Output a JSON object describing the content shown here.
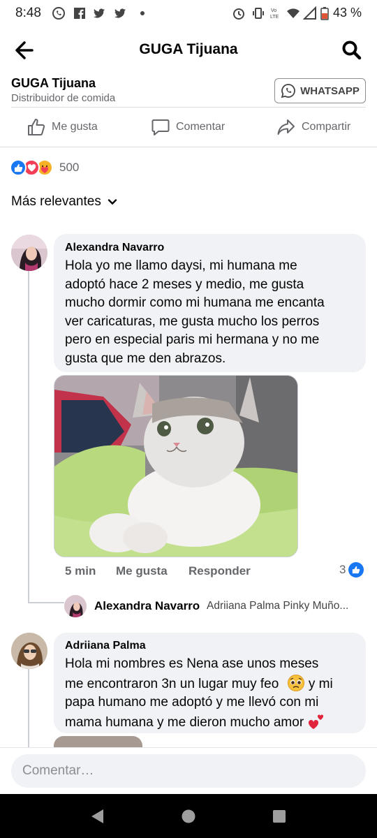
{
  "status_bar": {
    "time": "8:48",
    "battery": "43 %"
  },
  "top_bar": {
    "title": "GUGA Tijuana"
  },
  "page_header": {
    "name": "GUGA Tijuana",
    "category": "Distribuidor de comida",
    "whatsapp_label": "WHATSAPP"
  },
  "actions": {
    "like": "Me gusta",
    "comment": "Comentar",
    "share": "Compartir"
  },
  "reactions": {
    "count": "500",
    "types": [
      "like",
      "love",
      "care"
    ]
  },
  "sort": {
    "label": "Más relevantes"
  },
  "comments": [
    {
      "author": "Alexandra Navarro",
      "lines": [
        "Hola yo me llamo daysi, mi humana me",
        "adoptó hace 2 meses y medio, me gusta",
        "mucho dormir como mi humana me encanta",
        "ver caricaturas, me gusta mucho los perros",
        "pero en especial paris mi hermana y no me",
        "gusta que me den abrazos."
      ],
      "time": "5 min",
      "like_label": "Me gusta",
      "reply_label": "Responder",
      "like_count": "3",
      "reply_preview": {
        "author": "Alexandra Navarro",
        "text": "Adriiana Palma Pinky Muño..."
      }
    },
    {
      "author": "Adriiana Palma",
      "lines": [
        "Hola mi nombres es Nena ase unos meses",
        "me encontraron 3n un lugar muy feo",
        "y mi",
        "papa humano me  adoptó  y me llevó con mi",
        "mama humana y me dieron mucho amor"
      ]
    }
  ],
  "composer": {
    "placeholder": "Comentar…"
  },
  "colors": {
    "accent": "#1877f2",
    "love": "#f33e58",
    "care": "#f7b125",
    "bubble": "#f0f2f5",
    "whatsapp_border": "#8a8d91"
  }
}
